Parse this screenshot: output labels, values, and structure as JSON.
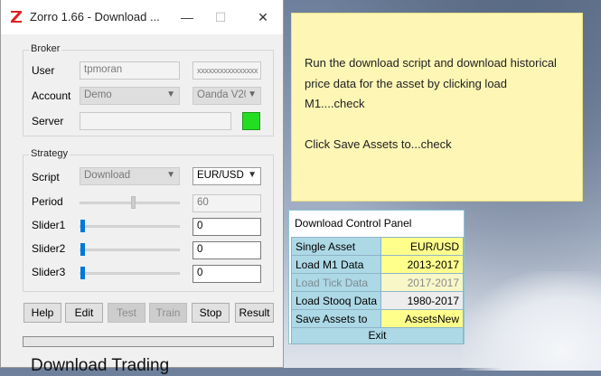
{
  "window": {
    "title": "Zorro 1.66 - Download ...",
    "minimize_glyph": "—",
    "maximize_glyph": "☐",
    "close_glyph": "✕"
  },
  "broker": {
    "group_label": "Broker",
    "user_label": "User",
    "user_value": "tpmoran",
    "password_value": "xxxxxxxxxxxxxxxx",
    "account_label": "Account",
    "account_value": "Demo",
    "broker_value": "Oanda V20",
    "server_label": "Server",
    "server_value": "",
    "status_color": "#22dd22"
  },
  "strategy": {
    "group_label": "Strategy",
    "script_label": "Script",
    "script_value": "Download",
    "asset_value": "EUR/USD",
    "period_label": "Period",
    "period_value": "60",
    "slider1_label": "Slider1",
    "slider1_value": "0",
    "slider2_label": "Slider2",
    "slider2_value": "0",
    "slider3_label": "Slider3",
    "slider3_value": "0"
  },
  "buttons": {
    "help": "Help",
    "edit": "Edit",
    "test": "Test",
    "train": "Train",
    "stop": "Stop",
    "result": "Result"
  },
  "progress": {
    "value": 0
  },
  "status_text": "Download Trading",
  "note": {
    "line1": "Run the download script and download historical price data for the asset by clicking load M1....check",
    "line2": "Click Save Assets to...check"
  },
  "panel": {
    "title": "Download Control Panel",
    "rows": [
      {
        "label": "Single Asset",
        "value": "EUR/USD"
      },
      {
        "label": "Load M1 Data",
        "value": "2013-2017"
      },
      {
        "label": "Load Tick Data",
        "value": "2017-2017"
      },
      {
        "label": "Load Stooq Data",
        "value": "1980-2017"
      },
      {
        "label": "Save Assets to",
        "value": "AssetsNew"
      }
    ],
    "exit_label": "Exit"
  },
  "icons": {
    "app_logo": "zorro-z-logo-icon",
    "dropdown": "chevron-down-icon"
  },
  "colors": {
    "accent_blue": "#0078d7",
    "panel_key_bg": "#add8e6",
    "panel_value_bg": "#ffff8c",
    "note_bg": "#fdf6b5"
  }
}
